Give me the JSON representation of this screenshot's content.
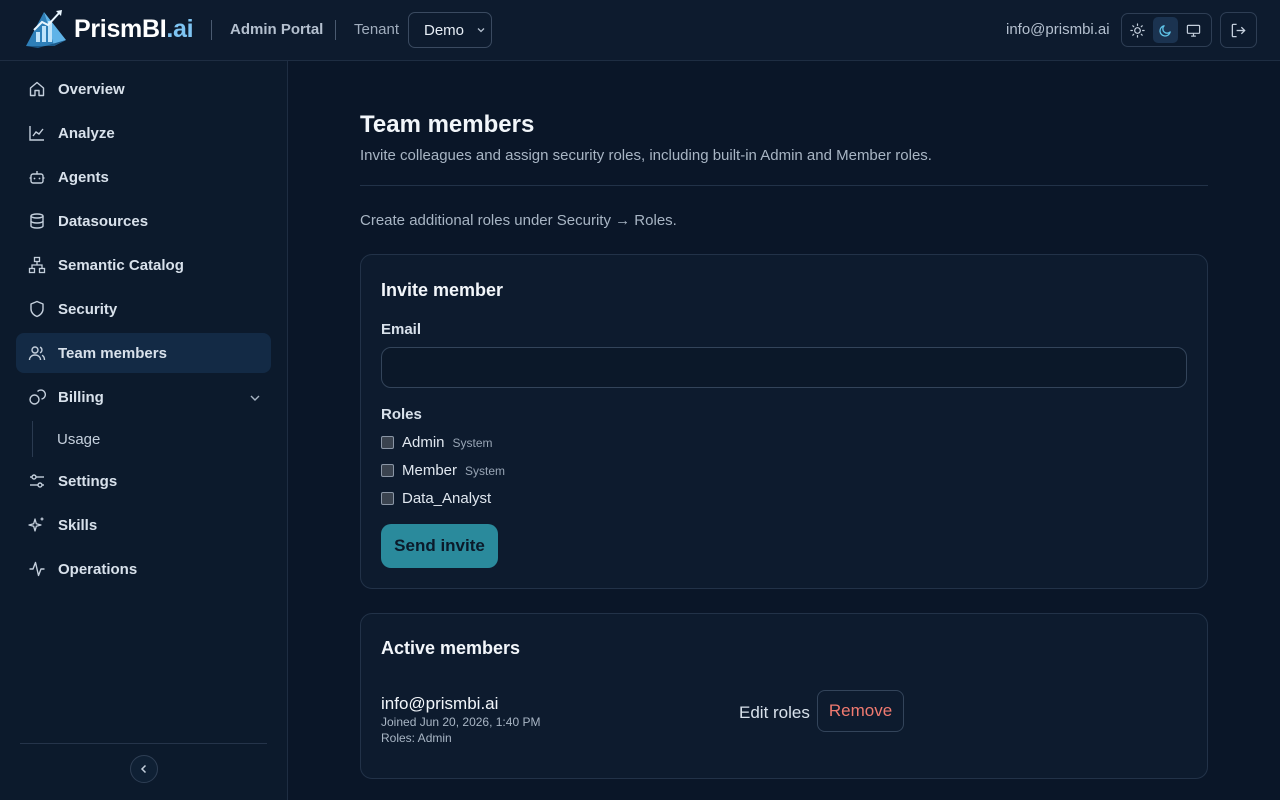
{
  "header": {
    "logo_main": "PrismBI",
    "logo_suffix": ".ai",
    "portal": "Admin Portal",
    "tenant_label": "Tenant",
    "tenant_value": "Demo",
    "user_email": "info@prismbi.ai",
    "theme_options": [
      "sun-icon",
      "moon-icon",
      "monitor-icon"
    ],
    "active_theme": "moon-icon"
  },
  "sidebar": {
    "items": [
      {
        "label": "Overview",
        "icon": "home-icon"
      },
      {
        "label": "Analyze",
        "icon": "chart-line-icon"
      },
      {
        "label": "Agents",
        "icon": "bot-icon"
      },
      {
        "label": "Datasources",
        "icon": "database-icon"
      },
      {
        "label": "Semantic Catalog",
        "icon": "hierarchy-icon"
      },
      {
        "label": "Security",
        "icon": "shield-icon"
      },
      {
        "label": "Team members",
        "icon": "users-icon",
        "active": true
      },
      {
        "label": "Billing",
        "icon": "billing-icon",
        "expanded": true
      },
      {
        "label": "Settings",
        "icon": "sliders-icon"
      },
      {
        "label": "Skills",
        "icon": "sparkles-icon"
      },
      {
        "label": "Operations",
        "icon": "activity-icon"
      }
    ],
    "billing_sub": [
      "Usage"
    ]
  },
  "main": {
    "title": "Team members",
    "subtitle": "Invite colleagues and assign security roles, including built-in Admin and Member roles.",
    "hint": "Create additional roles under Security → Roles.",
    "invite": {
      "title": "Invite member",
      "email_label": "Email",
      "email_value": "",
      "roles_label": "Roles",
      "roles": [
        {
          "name": "Admin",
          "tag": "System"
        },
        {
          "name": "Member",
          "tag": "System"
        },
        {
          "name": "Data_Analyst",
          "tag": ""
        }
      ],
      "send_label": "Send invite"
    },
    "active": {
      "title": "Active members",
      "members": [
        {
          "email": "info@prismbi.ai",
          "joined": "Joined Jun 20, 2026, 1:40 PM",
          "roles": "Roles: Admin",
          "edit_label": "Edit roles",
          "remove_label": "Remove"
        }
      ]
    }
  },
  "colors": {
    "accent": "#2a8a9c",
    "danger": "#f07a70",
    "active_nav": "#132a45",
    "background": "#0a1628"
  }
}
